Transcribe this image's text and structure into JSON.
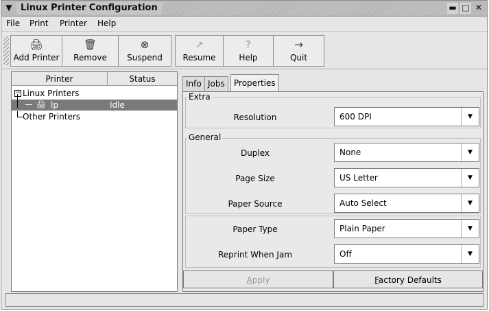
{
  "window": {
    "title": "Linux Printer Configuration",
    "menu_icon": "▼",
    "minimize": "▬",
    "maximize": "□",
    "close": "✕"
  },
  "menubar": {
    "items": [
      "File",
      "Print",
      "Printer",
      "Help"
    ]
  },
  "toolbar": {
    "buttons": [
      {
        "label": "Add Printer",
        "icon": "printer-icon",
        "glyph": "🖨"
      },
      {
        "label": "Remove",
        "icon": "trash-icon",
        "glyph": "🗑"
      },
      {
        "label": "Suspend",
        "icon": "stop-icon",
        "glyph": "⊗"
      },
      {
        "label": "Resume",
        "icon": "resume-arrow-icon",
        "glyph": "↗"
      },
      {
        "label": "Help",
        "icon": "help-icon",
        "glyph": "?"
      },
      {
        "label": "Quit",
        "icon": "quit-icon",
        "glyph": "→"
      }
    ]
  },
  "printer_list": {
    "columns": [
      "Printer",
      "Status"
    ],
    "groups": [
      {
        "name": "Linux Printers",
        "expander": "−"
      },
      {
        "name": "Other Printers"
      }
    ],
    "printers": [
      {
        "name": "lp",
        "status": "Idle",
        "icon": "printer-icon"
      }
    ]
  },
  "tabs": [
    "Info",
    "Jobs",
    "Properties"
  ],
  "active_tab": "Properties",
  "properties": {
    "extra_title": "Extra",
    "general_title": "General",
    "resolution": {
      "label": "Resolution",
      "value": "600 DPI"
    },
    "duplex": {
      "label": "Duplex",
      "value": "None"
    },
    "page_size": {
      "label": "Page Size",
      "value": "US Letter"
    },
    "paper_source": {
      "label": "Paper Source",
      "value": "Auto Select"
    },
    "paper_type": {
      "label": "Paper Type",
      "value": "Plain Paper"
    },
    "reprint": {
      "label": "Reprint When Jam",
      "value": "Off"
    },
    "dropdown_arrow": "▼"
  },
  "actions": {
    "apply": {
      "pre": "",
      "mnemonic": "A",
      "post": "pply"
    },
    "factory": {
      "pre": "",
      "mnemonic": "F",
      "post": "actory Defaults"
    }
  },
  "colors": {
    "selection": "#7a7a7a",
    "disabled_text": "#9a9a9a"
  }
}
